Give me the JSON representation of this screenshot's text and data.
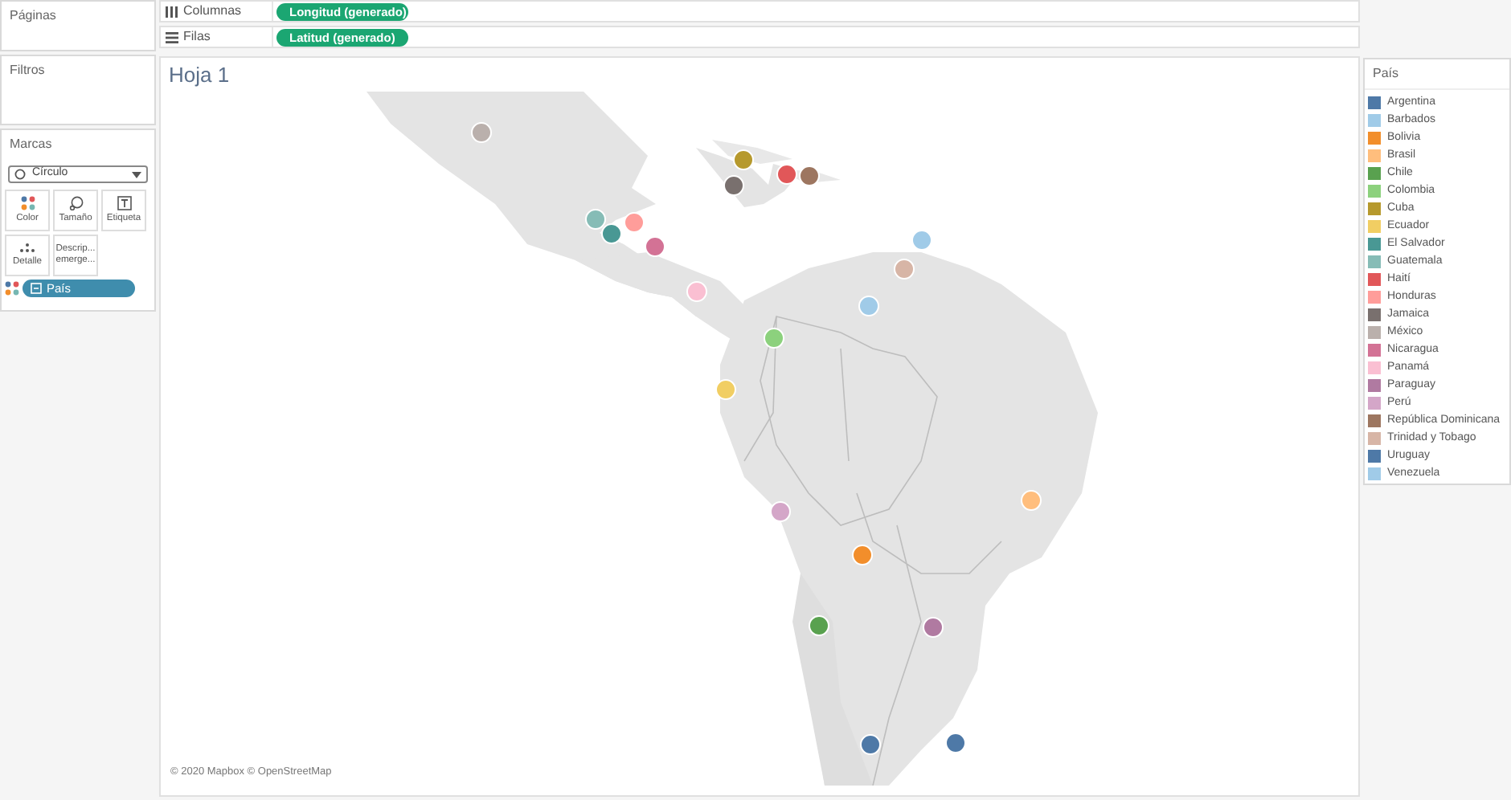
{
  "left_panel": {
    "pages": {
      "title": "Páginas"
    },
    "filters": {
      "title": "Filtros"
    },
    "marks": {
      "title": "Marcas",
      "mark_type": "Círculo",
      "buttons": [
        {
          "label": "Color",
          "kind": "color"
        },
        {
          "label": "Tamaño",
          "kind": "size"
        },
        {
          "label": "Etiqueta",
          "kind": "label"
        },
        {
          "label": "Detalle",
          "kind": "detail"
        },
        {
          "label": "Descrip... emerge...",
          "kind": "tooltip"
        }
      ],
      "field_pill": {
        "label": "País",
        "kind": "color"
      }
    }
  },
  "shelves": [
    {
      "label": "Columnas",
      "kind": "columns",
      "pill": "Longitud (generado)"
    },
    {
      "label": "Filas",
      "kind": "rows",
      "pill": "Latitud (generado)"
    }
  ],
  "sheet": {
    "title": "Hoja 1",
    "attribution": "© 2020 Mapbox © OpenStreetMap"
  },
  "legend": {
    "title": "País",
    "items": [
      {
        "label": "Argentina",
        "color": "#4e79a7"
      },
      {
        "label": "Barbados",
        "color": "#a0cbe8"
      },
      {
        "label": "Bolivia",
        "color": "#f28e2b"
      },
      {
        "label": "Brasil",
        "color": "#ffbe7d"
      },
      {
        "label": "Chile",
        "color": "#59a14f"
      },
      {
        "label": "Colombia",
        "color": "#8cd17d"
      },
      {
        "label": "Cuba",
        "color": "#b6992d"
      },
      {
        "label": "Ecuador",
        "color": "#f1ce63"
      },
      {
        "label": "El Salvador",
        "color": "#499894"
      },
      {
        "label": "Guatemala",
        "color": "#86bcb6"
      },
      {
        "label": "Haití",
        "color": "#e15759"
      },
      {
        "label": "Honduras",
        "color": "#ff9d9a"
      },
      {
        "label": "Jamaica",
        "color": "#79706e"
      },
      {
        "label": "México",
        "color": "#bab0ac"
      },
      {
        "label": "Nicaragua",
        "color": "#d37295"
      },
      {
        "label": "Panamá",
        "color": "#fabfd2"
      },
      {
        "label": "Paraguay",
        "color": "#b07aa1"
      },
      {
        "label": "Perú",
        "color": "#d4a6c8"
      },
      {
        "label": "República Dominicana",
        "color": "#9d7660"
      },
      {
        "label": "Trinidad y Tobago",
        "color": "#d7b5a6"
      },
      {
        "label": "Uruguay",
        "color": "#4e79a7"
      },
      {
        "label": "Venezuela",
        "color": "#a0cbe8"
      }
    ]
  }
}
